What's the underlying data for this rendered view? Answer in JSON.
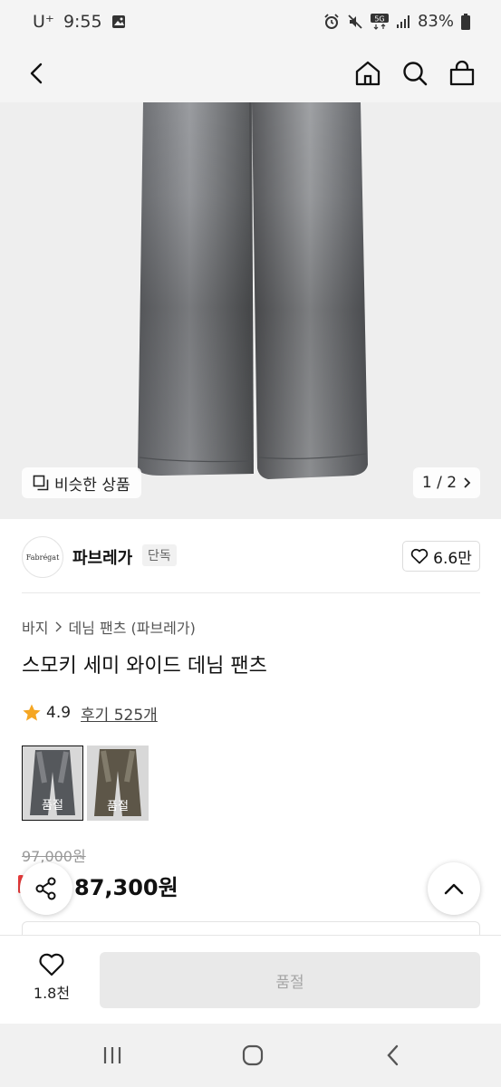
{
  "status_bar": {
    "carrier": "U⁺",
    "time": "9:55",
    "network": "5G",
    "battery": "83%"
  },
  "header": {
    "back_icon": "chevron-left-icon",
    "home_icon": "home-icon",
    "search_icon": "search-icon",
    "cart_icon": "shopping-bag-icon"
  },
  "gallery": {
    "similar_label": "비슷한 상품",
    "page_counter": "1 / 2",
    "current": 1,
    "total": 2
  },
  "brand": {
    "logo_text": "Fabrégat",
    "name": "파브레가",
    "badge": "단독",
    "likes": "6.6만"
  },
  "product": {
    "breadcrumb": [
      "바지",
      "데님 팬츠 (파브레가)"
    ],
    "title": "스모키 세미 와이드 데님 팬츠",
    "rating": "4.9",
    "reviews": "후기 525개",
    "options": [
      {
        "label": "품절",
        "color": "#4a4c50",
        "selected": true
      },
      {
        "label": "품절",
        "color": "#5a5447",
        "selected": false
      }
    ],
    "original_price": "97,000원",
    "sale_price": "87,300원"
  },
  "bottom_bar": {
    "wish_count": "1.8천",
    "buy_label": "품절"
  },
  "colors": {
    "accent_red": "#e83b3b",
    "star": "#f5a623",
    "denim": "#5f6266"
  }
}
